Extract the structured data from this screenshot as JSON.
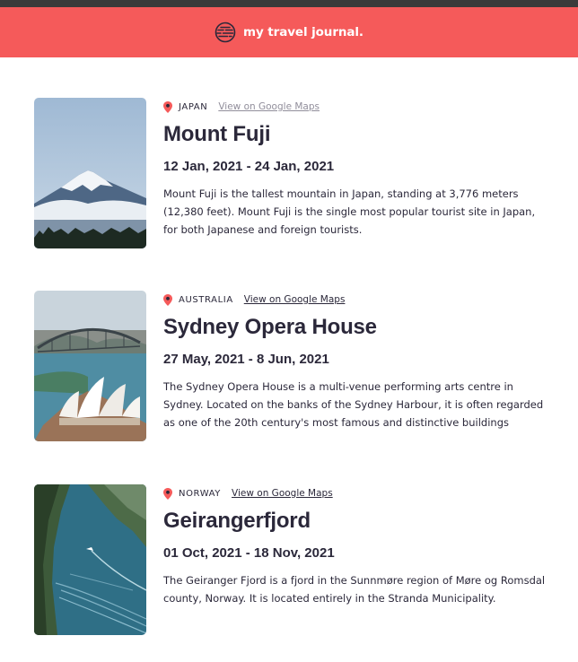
{
  "header": {
    "title": "my travel journal.",
    "brand_color": "#F55A5A",
    "icon": "globe-icon"
  },
  "entries": [
    {
      "country": "JAPAN",
      "map_link": "View on Google Maps",
      "place": "Mount Fuji",
      "dates": "12 Jan, 2021 - 24 Jan, 2021",
      "description": "Mount Fuji is the tallest mountain in Japan, standing at 3,776 meters (12,380 feet). Mount Fuji is the single most popular tourist site in Japan, for both Japanese and foreign tourists."
    },
    {
      "country": "AUSTRALIA",
      "map_link": "View on Google Maps",
      "place": "Sydney Opera House",
      "dates": "27 May, 2021 - 8 Jun, 2021",
      "description": "The Sydney Opera House is a multi-venue performing arts centre in Sydney. Located on the banks of the Sydney Harbour, it is often regarded as one of the 20th century's most famous and distinctive buildings"
    },
    {
      "country": "NORWAY",
      "map_link": "View on Google Maps",
      "place": "Geirangerfjord",
      "dates": "01 Oct, 2021 - 18 Nov, 2021",
      "description": "The Geiranger Fjord is a fjord in the Sunnmøre region of Møre og Romsdal county, Norway. It is located entirely in the Stranda Municipality."
    }
  ]
}
